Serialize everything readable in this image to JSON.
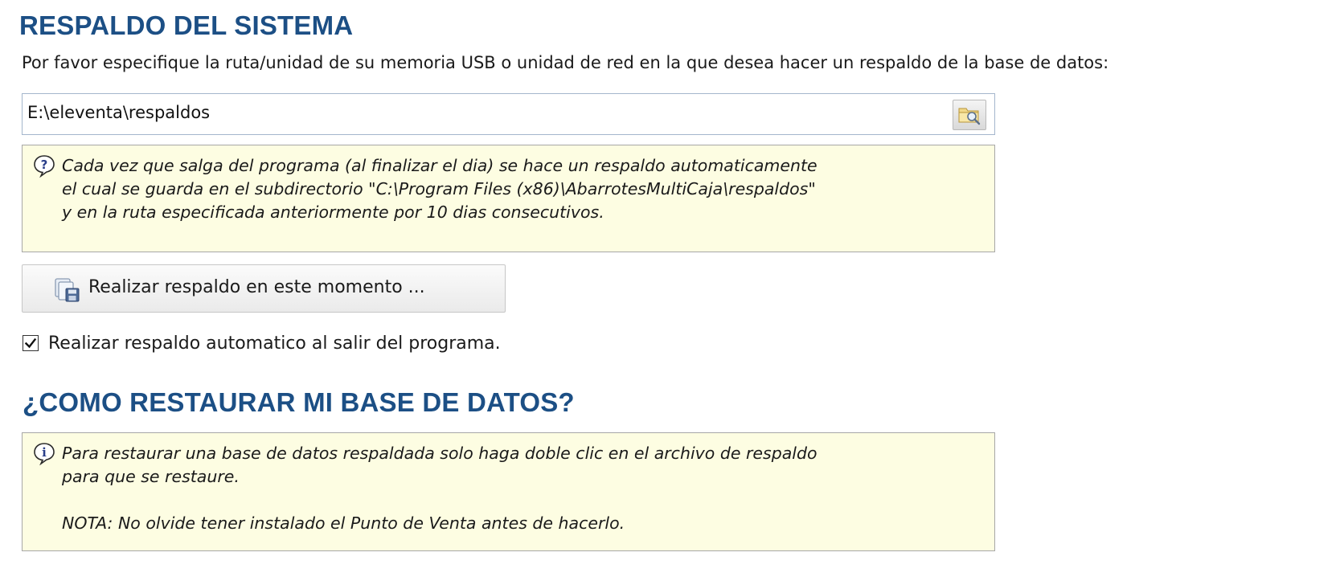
{
  "backup": {
    "title": "RESPALDO DEL SISTEMA",
    "instructions": "Por favor especifique la ruta/unidad de su memoria USB o unidad de red en la que desea hacer un respaldo de la base de datos:",
    "path_value": "E:\\eleventa\\respaldos",
    "browse_icon": "folder-search-icon",
    "info": {
      "icon": "help-icon",
      "lines": [
        "Cada vez que salga del programa (al finalizar el dia) se hace un respaldo automaticamente",
        "el cual se guarda en el subdirectorio \"C:\\Program Files (x86)\\AbarrotesMultiCaja\\respaldos\"",
        "y en la ruta especificada anteriormente por 10 dias consecutivos."
      ]
    },
    "backup_now_label": "Realizar respaldo en este momento ...",
    "backup_now_icon": "backup-disk-icon",
    "auto_backup_label": "Realizar respaldo automatico al salir del programa.",
    "auto_backup_checked": true
  },
  "restore": {
    "title": "¿COMO RESTAURAR MI BASE DE DATOS?",
    "info": {
      "icon": "info-icon",
      "lines": [
        "Para restaurar una base de datos respaldada solo haga doble clic en el archivo de respaldo",
        "para que se restaure.",
        "",
        "NOTA: No olvide tener instalado el Punto de Venta antes de hacerlo."
      ]
    }
  },
  "colors": {
    "heading": "#1c4f85",
    "note_background": "#fdfde2",
    "note_border": "#a7a7a7",
    "field_border": "#a4b6cc"
  }
}
